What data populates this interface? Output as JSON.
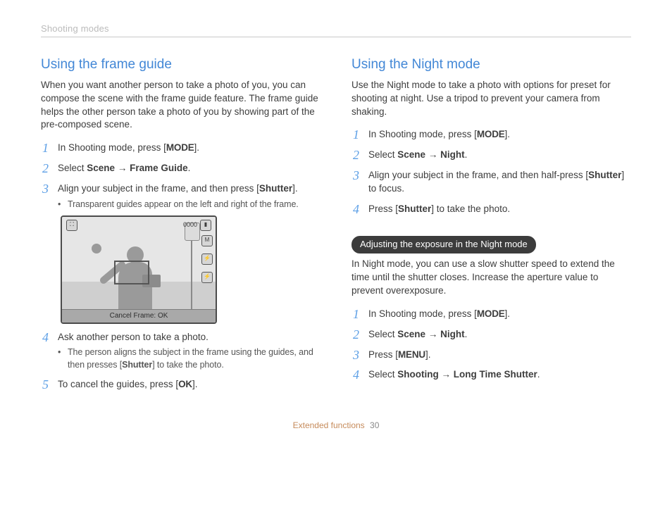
{
  "header": {
    "running_head": "Shooting modes"
  },
  "left": {
    "title": "Using the frame guide",
    "intro": "When you want another person to take a photo of you, you can compose the scene with the frame guide feature. The frame guide helps the other person take a photo of you by showing part of the pre-composed scene.",
    "steps": {
      "s1_a": "In Shooting mode, press [",
      "s1_btn": "MODE",
      "s1_b": "].",
      "s2_a": "Select ",
      "s2_b": "Scene",
      "s2_arrow": " → ",
      "s2_c": "Frame Guide",
      "s2_d": ".",
      "s3_a": "Align your subject in the frame, and then press [",
      "s3_btn": "Shutter",
      "s3_b": "].",
      "s3_sub": "Transparent guides appear on the left and right of the frame.",
      "s4_a": "Ask another person to take a photo.",
      "s4_sub_a": "The person aligns the subject in the frame using the guides, and then presses [",
      "s4_sub_btn": "Shutter",
      "s4_sub_b": "] to take the photo.",
      "s5_a": "To cancel the guides, press [",
      "s5_btn": "OK",
      "s5_b": "]."
    },
    "lcd": {
      "counter": "0000",
      "cancel": "Cancel Frame: OK"
    }
  },
  "right": {
    "title": "Using the Night mode",
    "intro": "Use the Night mode to take a photo with options for preset for shooting at night. Use a tripod to prevent your camera from shaking.",
    "steps": {
      "s1_a": "In Shooting mode, press [",
      "s1_btn": "MODE",
      "s1_b": "].",
      "s2_a": "Select ",
      "s2_b": "Scene",
      "s2_arrow": " → ",
      "s2_c": "Night",
      "s2_d": ".",
      "s3_a": "Align your subject in the frame, and then half-press [",
      "s3_btn": "Shutter",
      "s3_b": "] to focus.",
      "s4_a": "Press [",
      "s4_btn": "Shutter",
      "s4_b": "] to take the photo."
    },
    "sub": {
      "pill": "Adjusting the exposure in the Night mode",
      "intro": "In Night mode, you can use a slow shutter speed to extend the time until the shutter closes. Increase the aperture value to prevent overexposure.",
      "steps": {
        "s1_a": "In Shooting mode, press [",
        "s1_btn": "MODE",
        "s1_b": "].",
        "s2_a": "Select ",
        "s2_b": "Scene",
        "s2_arrow": " → ",
        "s2_c": "Night",
        "s2_d": ".",
        "s3_a": "Press [",
        "s3_btn": "MENU",
        "s3_b": "].",
        "s4_a": "Select ",
        "s4_b": "Shooting",
        "s4_arrow": " → ",
        "s4_c": "Long Time Shutter",
        "s4_d": "."
      }
    }
  },
  "footer": {
    "section": "Extended functions",
    "page": "30"
  }
}
